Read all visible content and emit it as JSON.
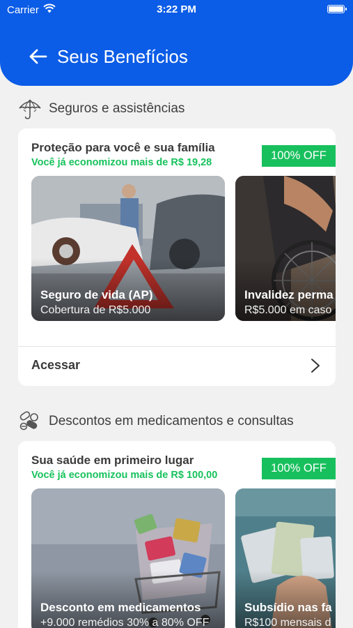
{
  "status_bar": {
    "carrier": "Carrier",
    "time": "3:22 PM"
  },
  "header": {
    "title": "Seus Benefícios"
  },
  "sections": [
    {
      "heading": "Seguros e assistências",
      "icon": "umbrella-icon",
      "card": {
        "title": "Proteção para você e sua família",
        "savings": "Você já economizou mais de R$ 19,28",
        "badge": "100% OFF",
        "tiles": [
          {
            "title": "Seguro de vida (AP)",
            "subtitle": "Cobertura de R$5.000"
          },
          {
            "title": "Invalidez perma",
            "subtitle": "R$5.000 em caso"
          }
        ],
        "action_label": "Acessar"
      }
    },
    {
      "heading": "Descontos em medicamentos e consultas",
      "icon": "pills-icon",
      "card": {
        "title": "Sua saúde em primeiro lugar",
        "savings": "Você já economizou mais de R$ 100,00",
        "badge": "100% OFF",
        "tiles": [
          {
            "title": "Desconto em medicamentos",
            "subtitle": "+9.000 remédios 30% a 80% OFF"
          },
          {
            "title": "Subsídio nas fa",
            "subtitle": "R$100 mensais d"
          }
        ]
      }
    }
  ],
  "colors": {
    "header_blue": "#0b5ce6",
    "badge_green": "#18c05d",
    "savings_green": "#17c25c",
    "background": "#f1f1f1"
  }
}
